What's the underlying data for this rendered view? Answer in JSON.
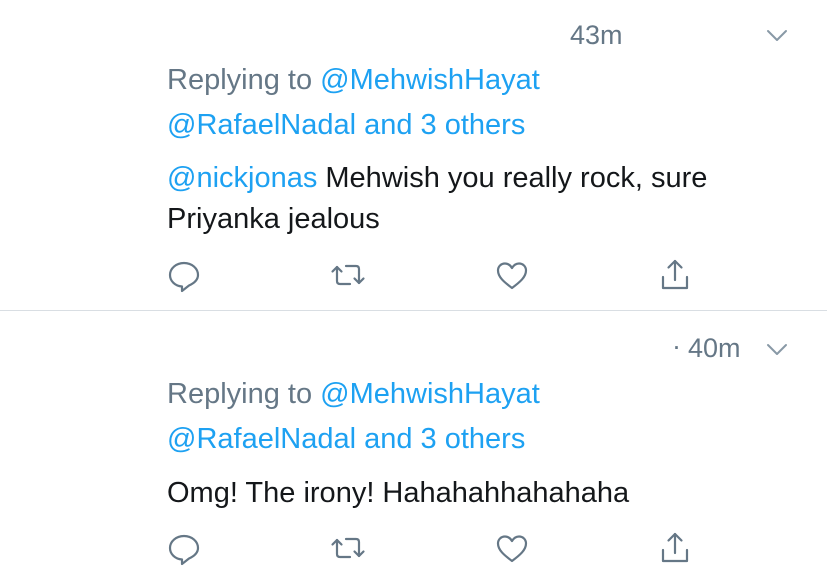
{
  "colors": {
    "muted": "#657786",
    "link": "#1da1f2",
    "text": "#14171a",
    "divider": "#d9dee3"
  },
  "tweets": [
    {
      "time": "43m",
      "replying_to_label": "Replying to",
      "replying_to_user": "@MehwishHayat",
      "others_user": "@RafaelNadal",
      "others_text": "and 3 others",
      "mention": "@nickjonas",
      "body": " Mehwish you really rock, sure Priyanka jealous"
    },
    {
      "dot": "·",
      "time": "40m",
      "replying_to_label": "Replying to",
      "replying_to_user": "@MehwishHayat",
      "others_user": "@RafaelNadal",
      "others_text": "and 3 others",
      "mention": "",
      "body": "Omg! The irony! Hahahahhahahaha"
    }
  ],
  "icons": {
    "menu": "chevron-down-icon",
    "reply": "reply-icon",
    "retweet": "retweet-icon",
    "like": "heart-icon",
    "share": "share-icon"
  }
}
